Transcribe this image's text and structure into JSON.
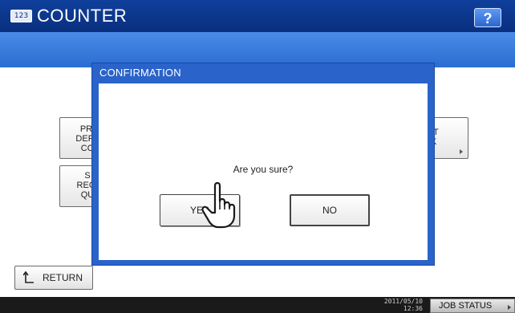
{
  "header": {
    "counter_icon": "123",
    "title": "COUNTER",
    "help_label": "?"
  },
  "menu": {
    "left_top_lines": [
      "PRI",
      "DEPA",
      "CO"
    ],
    "left_bottom_lines": [
      "S",
      "REGI",
      "QU"
    ],
    "right_lines": [
      "IT",
      "K"
    ]
  },
  "dialog": {
    "title": "CONFIRMATION",
    "message": "Are you sure?",
    "yes_label": "YES",
    "no_label": "NO"
  },
  "footer": {
    "return_label": "RETURN",
    "date": "2011/05/10",
    "time": "12:36",
    "job_status_label": "JOB STATUS"
  },
  "icons": {
    "counter": "counter-icon",
    "help": "help-icon",
    "return": "return-arrow-icon",
    "pointer": "hand-pointer-icon"
  }
}
